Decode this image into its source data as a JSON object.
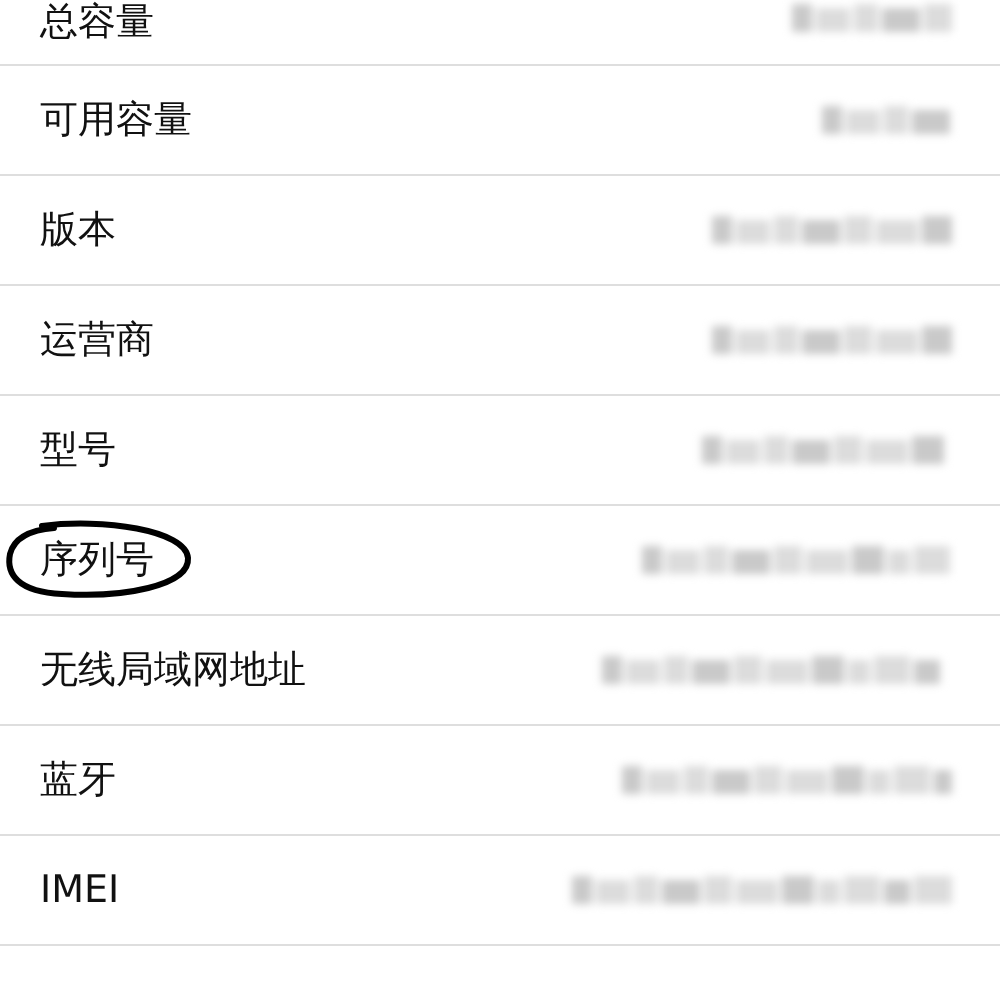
{
  "rows": [
    {
      "label": "总容量",
      "circled": false
    },
    {
      "label": "可用容量",
      "circled": false
    },
    {
      "label": "版本",
      "circled": false
    },
    {
      "label": "运营商",
      "circled": false
    },
    {
      "label": "型号",
      "circled": false
    },
    {
      "label": "序列号",
      "circled": true
    },
    {
      "label": "无线局域网地址",
      "circled": false
    },
    {
      "label": "蓝牙",
      "circled": false
    },
    {
      "label": "IMEI",
      "circled": false
    }
  ]
}
